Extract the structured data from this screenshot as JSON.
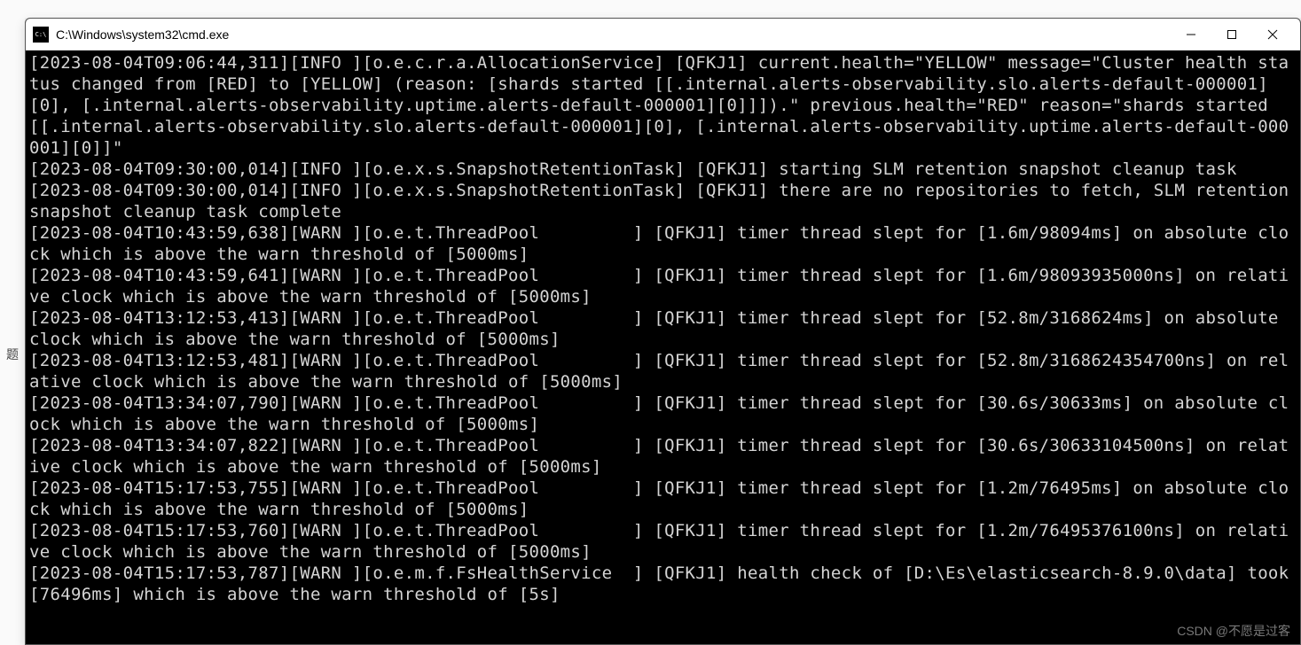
{
  "background": {
    "left_label": "题"
  },
  "window": {
    "title": "C:\\Windows\\system32\\cmd.exe"
  },
  "console": {
    "lines": [
      "[2023-08-04T09:06:44,311][INFO ][o.e.c.r.a.AllocationService] [QFKJ1] current.health=\"YELLOW\" message=\"Cluster health status changed from [RED] to [YELLOW] (reason: [shards started [[.internal.alerts-observability.slo.alerts-default-000001][0], [.internal.alerts-observability.uptime.alerts-default-000001][0]]]).\" previous.health=\"RED\" reason=\"shards started [[.internal.alerts-observability.slo.alerts-default-000001][0], [.internal.alerts-observability.uptime.alerts-default-000001][0]]\"",
      "[2023-08-04T09:30:00,014][INFO ][o.e.x.s.SnapshotRetentionTask] [QFKJ1] starting SLM retention snapshot cleanup task",
      "[2023-08-04T09:30:00,014][INFO ][o.e.x.s.SnapshotRetentionTask] [QFKJ1] there are no repositories to fetch, SLM retention snapshot cleanup task complete",
      "[2023-08-04T10:43:59,638][WARN ][o.e.t.ThreadPool         ] [QFKJ1] timer thread slept for [1.6m/98094ms] on absolute clock which is above the warn threshold of [5000ms]",
      "[2023-08-04T10:43:59,641][WARN ][o.e.t.ThreadPool         ] [QFKJ1] timer thread slept for [1.6m/98093935000ns] on relative clock which is above the warn threshold of [5000ms]",
      "[2023-08-04T13:12:53,413][WARN ][o.e.t.ThreadPool         ] [QFKJ1] timer thread slept for [52.8m/3168624ms] on absolute clock which is above the warn threshold of [5000ms]",
      "[2023-08-04T13:12:53,481][WARN ][o.e.t.ThreadPool         ] [QFKJ1] timer thread slept for [52.8m/3168624354700ns] on relative clock which is above the warn threshold of [5000ms]",
      "[2023-08-04T13:34:07,790][WARN ][o.e.t.ThreadPool         ] [QFKJ1] timer thread slept for [30.6s/30633ms] on absolute clock which is above the warn threshold of [5000ms]",
      "[2023-08-04T13:34:07,822][WARN ][o.e.t.ThreadPool         ] [QFKJ1] timer thread slept for [30.6s/30633104500ns] on relative clock which is above the warn threshold of [5000ms]",
      "[2023-08-04T15:17:53,755][WARN ][o.e.t.ThreadPool         ] [QFKJ1] timer thread slept for [1.2m/76495ms] on absolute clock which is above the warn threshold of [5000ms]",
      "[2023-08-04T15:17:53,760][WARN ][o.e.t.ThreadPool         ] [QFKJ1] timer thread slept for [1.2m/76495376100ns] on relative clock which is above the warn threshold of [5000ms]",
      "[2023-08-04T15:17:53,787][WARN ][o.e.m.f.FsHealthService  ] [QFKJ1] health check of [D:\\Es\\elasticsearch-8.9.0\\data] took [76496ms] which is above the warn threshold of [5s]"
    ]
  },
  "watermark": "CSDN @不愿是过客"
}
